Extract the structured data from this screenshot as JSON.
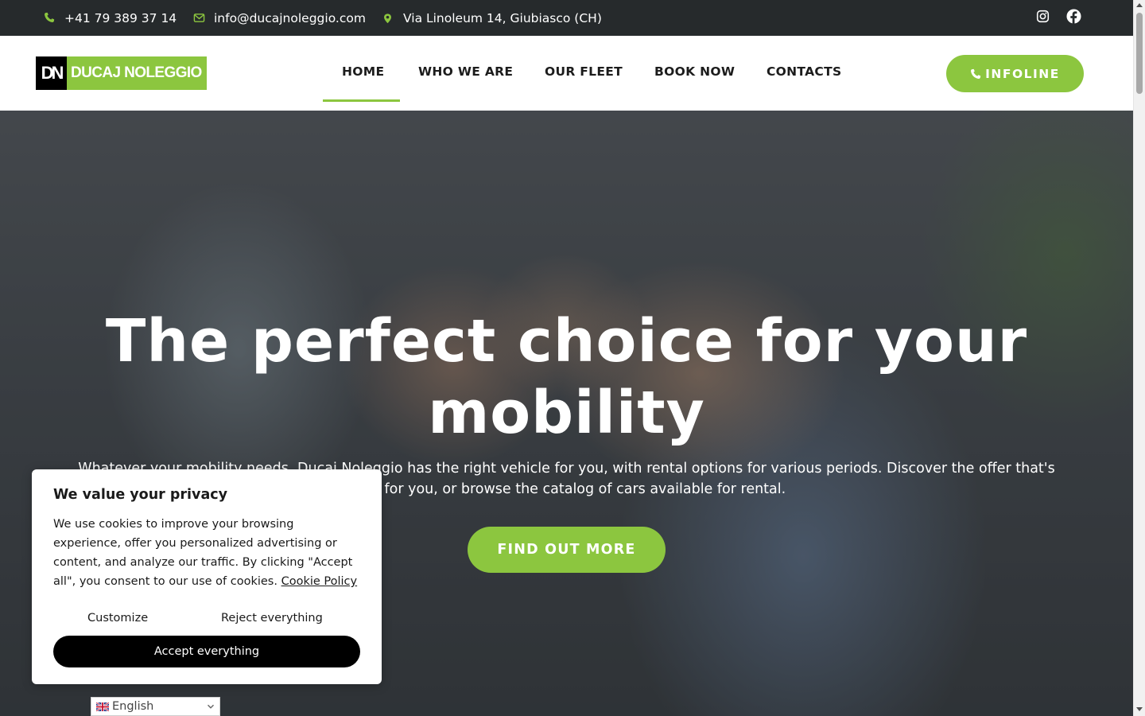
{
  "topbar": {
    "phone": "+41 79 389 37 14",
    "email": "info@ducajnoleggio.com",
    "address": "Via Linoleum 14, Giubiasco (CH)",
    "social": [
      "instagram-icon",
      "facebook-icon"
    ]
  },
  "header": {
    "logo_mark": "DN",
    "logo_text": "DUCAJ NOLEGGIO",
    "nav": [
      {
        "label": "HOME",
        "active": true
      },
      {
        "label": "WHO WE ARE",
        "active": false
      },
      {
        "label": "OUR FLEET",
        "active": false
      },
      {
        "label": "BOOK NOW",
        "active": false
      },
      {
        "label": "CONTACTS",
        "active": false
      }
    ],
    "infoline_label": "INFOLINE"
  },
  "hero": {
    "title": "The perfect choice for your mobility",
    "subtitle": "Whatever your mobility needs, Ducaj Noleggio has the right vehicle for you, with rental options for various periods. Discover the offer that's right for you, or browse the catalog of cars available for rental.",
    "cta_label": "FIND OUT MORE"
  },
  "cookie": {
    "title": "We value your privacy",
    "text": "We use cookies to improve your browsing experience, offer you personalized advertising or content, and analyze our traffic. By clicking \"Accept all\", you consent to our use of cookies.",
    "policy_link": "Cookie Policy",
    "customize_label": "Customize",
    "reject_label": "Reject everything",
    "accept_label": "Accept everything"
  },
  "language": {
    "selected": "English"
  },
  "colors": {
    "accent": "#8cc63f",
    "topbar_bg": "#262a2c",
    "text_dark": "#1c1c1c"
  }
}
